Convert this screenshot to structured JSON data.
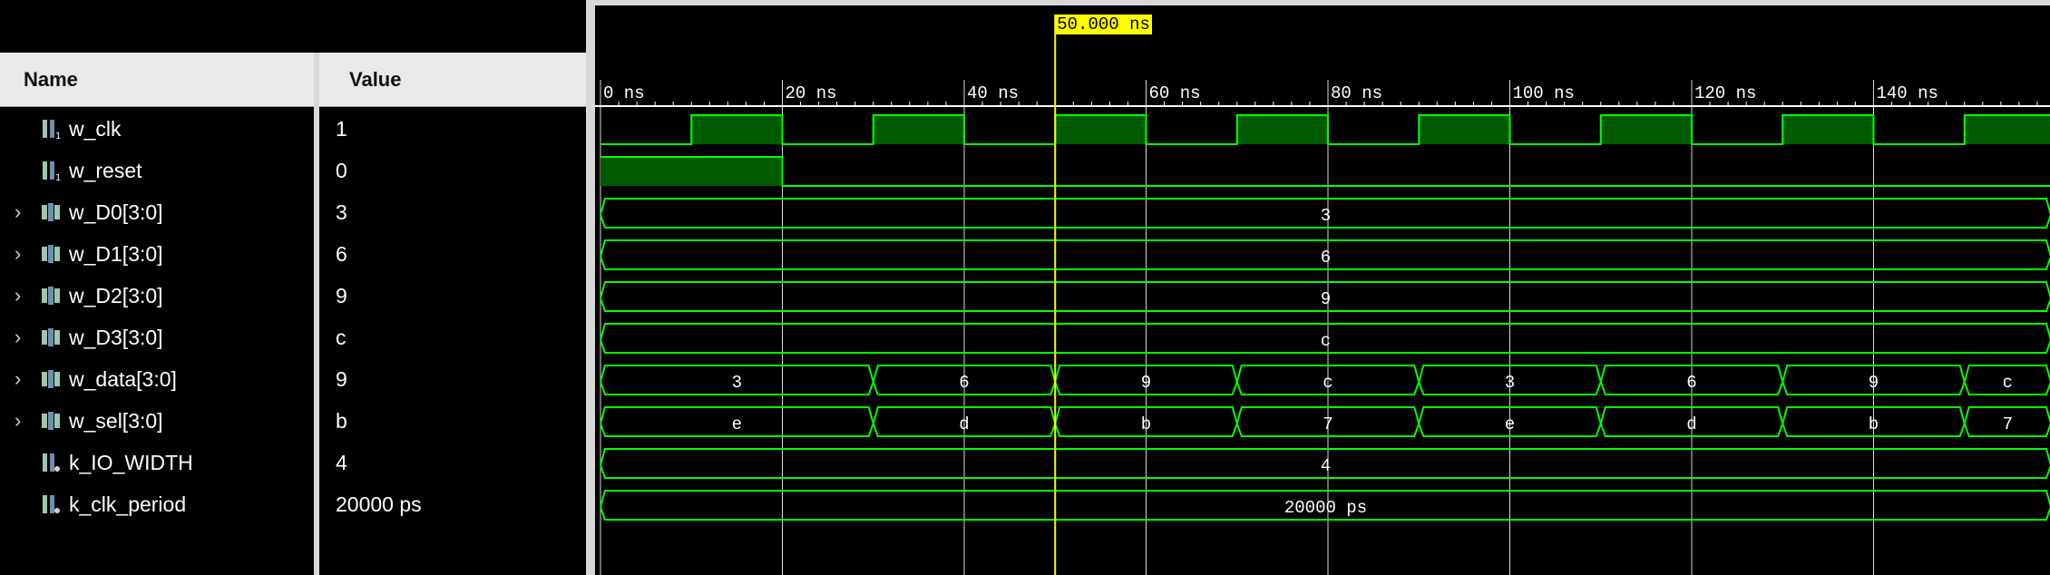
{
  "headers": {
    "name": "Name",
    "value": "Value"
  },
  "cursor": {
    "label": "50.000 ns",
    "time_ns": 50
  },
  "timeline": {
    "ticks": [
      "0 ns",
      "20 ns",
      "40 ns",
      "60 ns",
      "80 ns",
      "100 ns",
      "120 ns",
      "140 ns"
    ],
    "start_ns": 0,
    "end_ns": 159.5
  },
  "colors": {
    "wave": "#00ff00",
    "cursor": "#ffff00",
    "fill": "#005a00",
    "grid": "#ffffff"
  },
  "signals": [
    {
      "name": "w_clk",
      "value": "1",
      "icon": "bit-icon",
      "expandable": false,
      "kind": "clock",
      "period_ns": 20
    },
    {
      "name": "w_reset",
      "value": "0",
      "icon": "bit-icon",
      "expandable": false,
      "kind": "bit",
      "segments": [
        {
          "start": 0,
          "end": 20,
          "level": 1
        },
        {
          "start": 20,
          "end": 159.5,
          "level": 0
        }
      ]
    },
    {
      "name": "w_D0[3:0]",
      "value": "3",
      "icon": "bus-icon",
      "expandable": true,
      "kind": "bus",
      "segments": [
        {
          "start": 0,
          "end": 159.5,
          "label": "3"
        }
      ]
    },
    {
      "name": "w_D1[3:0]",
      "value": "6",
      "icon": "bus-icon",
      "expandable": true,
      "kind": "bus",
      "segments": [
        {
          "start": 0,
          "end": 159.5,
          "label": "6"
        }
      ]
    },
    {
      "name": "w_D2[3:0]",
      "value": "9",
      "icon": "bus-icon",
      "expandable": true,
      "kind": "bus",
      "segments": [
        {
          "start": 0,
          "end": 159.5,
          "label": "9"
        }
      ]
    },
    {
      "name": "w_D3[3:0]",
      "value": "c",
      "icon": "bus-icon",
      "expandable": true,
      "kind": "bus",
      "segments": [
        {
          "start": 0,
          "end": 159.5,
          "label": "c"
        }
      ]
    },
    {
      "name": "w_data[3:0]",
      "value": "9",
      "icon": "bus-icon",
      "expandable": true,
      "kind": "bus",
      "segments": [
        {
          "start": 0,
          "end": 30,
          "label": "3"
        },
        {
          "start": 30,
          "end": 50,
          "label": "6"
        },
        {
          "start": 50,
          "end": 70,
          "label": "9"
        },
        {
          "start": 70,
          "end": 90,
          "label": "c"
        },
        {
          "start": 90,
          "end": 110,
          "label": "3"
        },
        {
          "start": 110,
          "end": 130,
          "label": "6"
        },
        {
          "start": 130,
          "end": 150,
          "label": "9"
        },
        {
          "start": 150,
          "end": 159.5,
          "label": "c"
        }
      ]
    },
    {
      "name": "w_sel[3:0]",
      "value": "b",
      "icon": "bus-icon",
      "expandable": true,
      "kind": "bus",
      "segments": [
        {
          "start": 0,
          "end": 30,
          "label": "e"
        },
        {
          "start": 30,
          "end": 50,
          "label": "d"
        },
        {
          "start": 50,
          "end": 70,
          "label": "b"
        },
        {
          "start": 70,
          "end": 90,
          "label": "7"
        },
        {
          "start": 90,
          "end": 110,
          "label": "e"
        },
        {
          "start": 110,
          "end": 130,
          "label": "d"
        },
        {
          "start": 130,
          "end": 150,
          "label": "b"
        },
        {
          "start": 150,
          "end": 159.5,
          "label": "7"
        }
      ]
    },
    {
      "name": "k_IO_WIDTH",
      "value": "4",
      "icon": "param-icon",
      "expandable": false,
      "kind": "bus",
      "segments": [
        {
          "start": 0,
          "end": 159.5,
          "label": "4"
        }
      ]
    },
    {
      "name": "k_clk_period",
      "value": "20000 ps",
      "icon": "param-icon",
      "expandable": false,
      "kind": "bus",
      "segments": [
        {
          "start": 0,
          "end": 159.5,
          "label": "20000 ps"
        }
      ]
    }
  ]
}
